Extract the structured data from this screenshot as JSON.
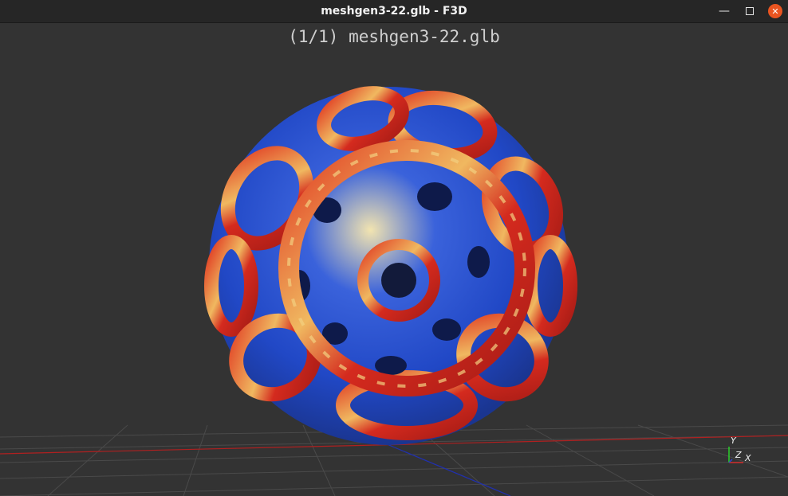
{
  "window": {
    "title": "meshgen3-22.glb - F3D",
    "controls": {
      "minimize_icon": "minimize-icon",
      "maximize_icon": "maximize-icon",
      "close_icon": "close-icon"
    }
  },
  "viewport": {
    "file_label": "(1/1) meshgen3-22.glb",
    "axes": {
      "x": "X",
      "y": "Y",
      "z": "Z"
    }
  },
  "colors": {
    "background": "#333333",
    "grid": "#4a4a4a",
    "x_axis": "#b02020",
    "z_axis": "#2030b0",
    "mesh_red": "#d42a1e",
    "mesh_blue": "#2a55d6",
    "mesh_yellow": "#f0d890",
    "close_button": "#e95420"
  }
}
